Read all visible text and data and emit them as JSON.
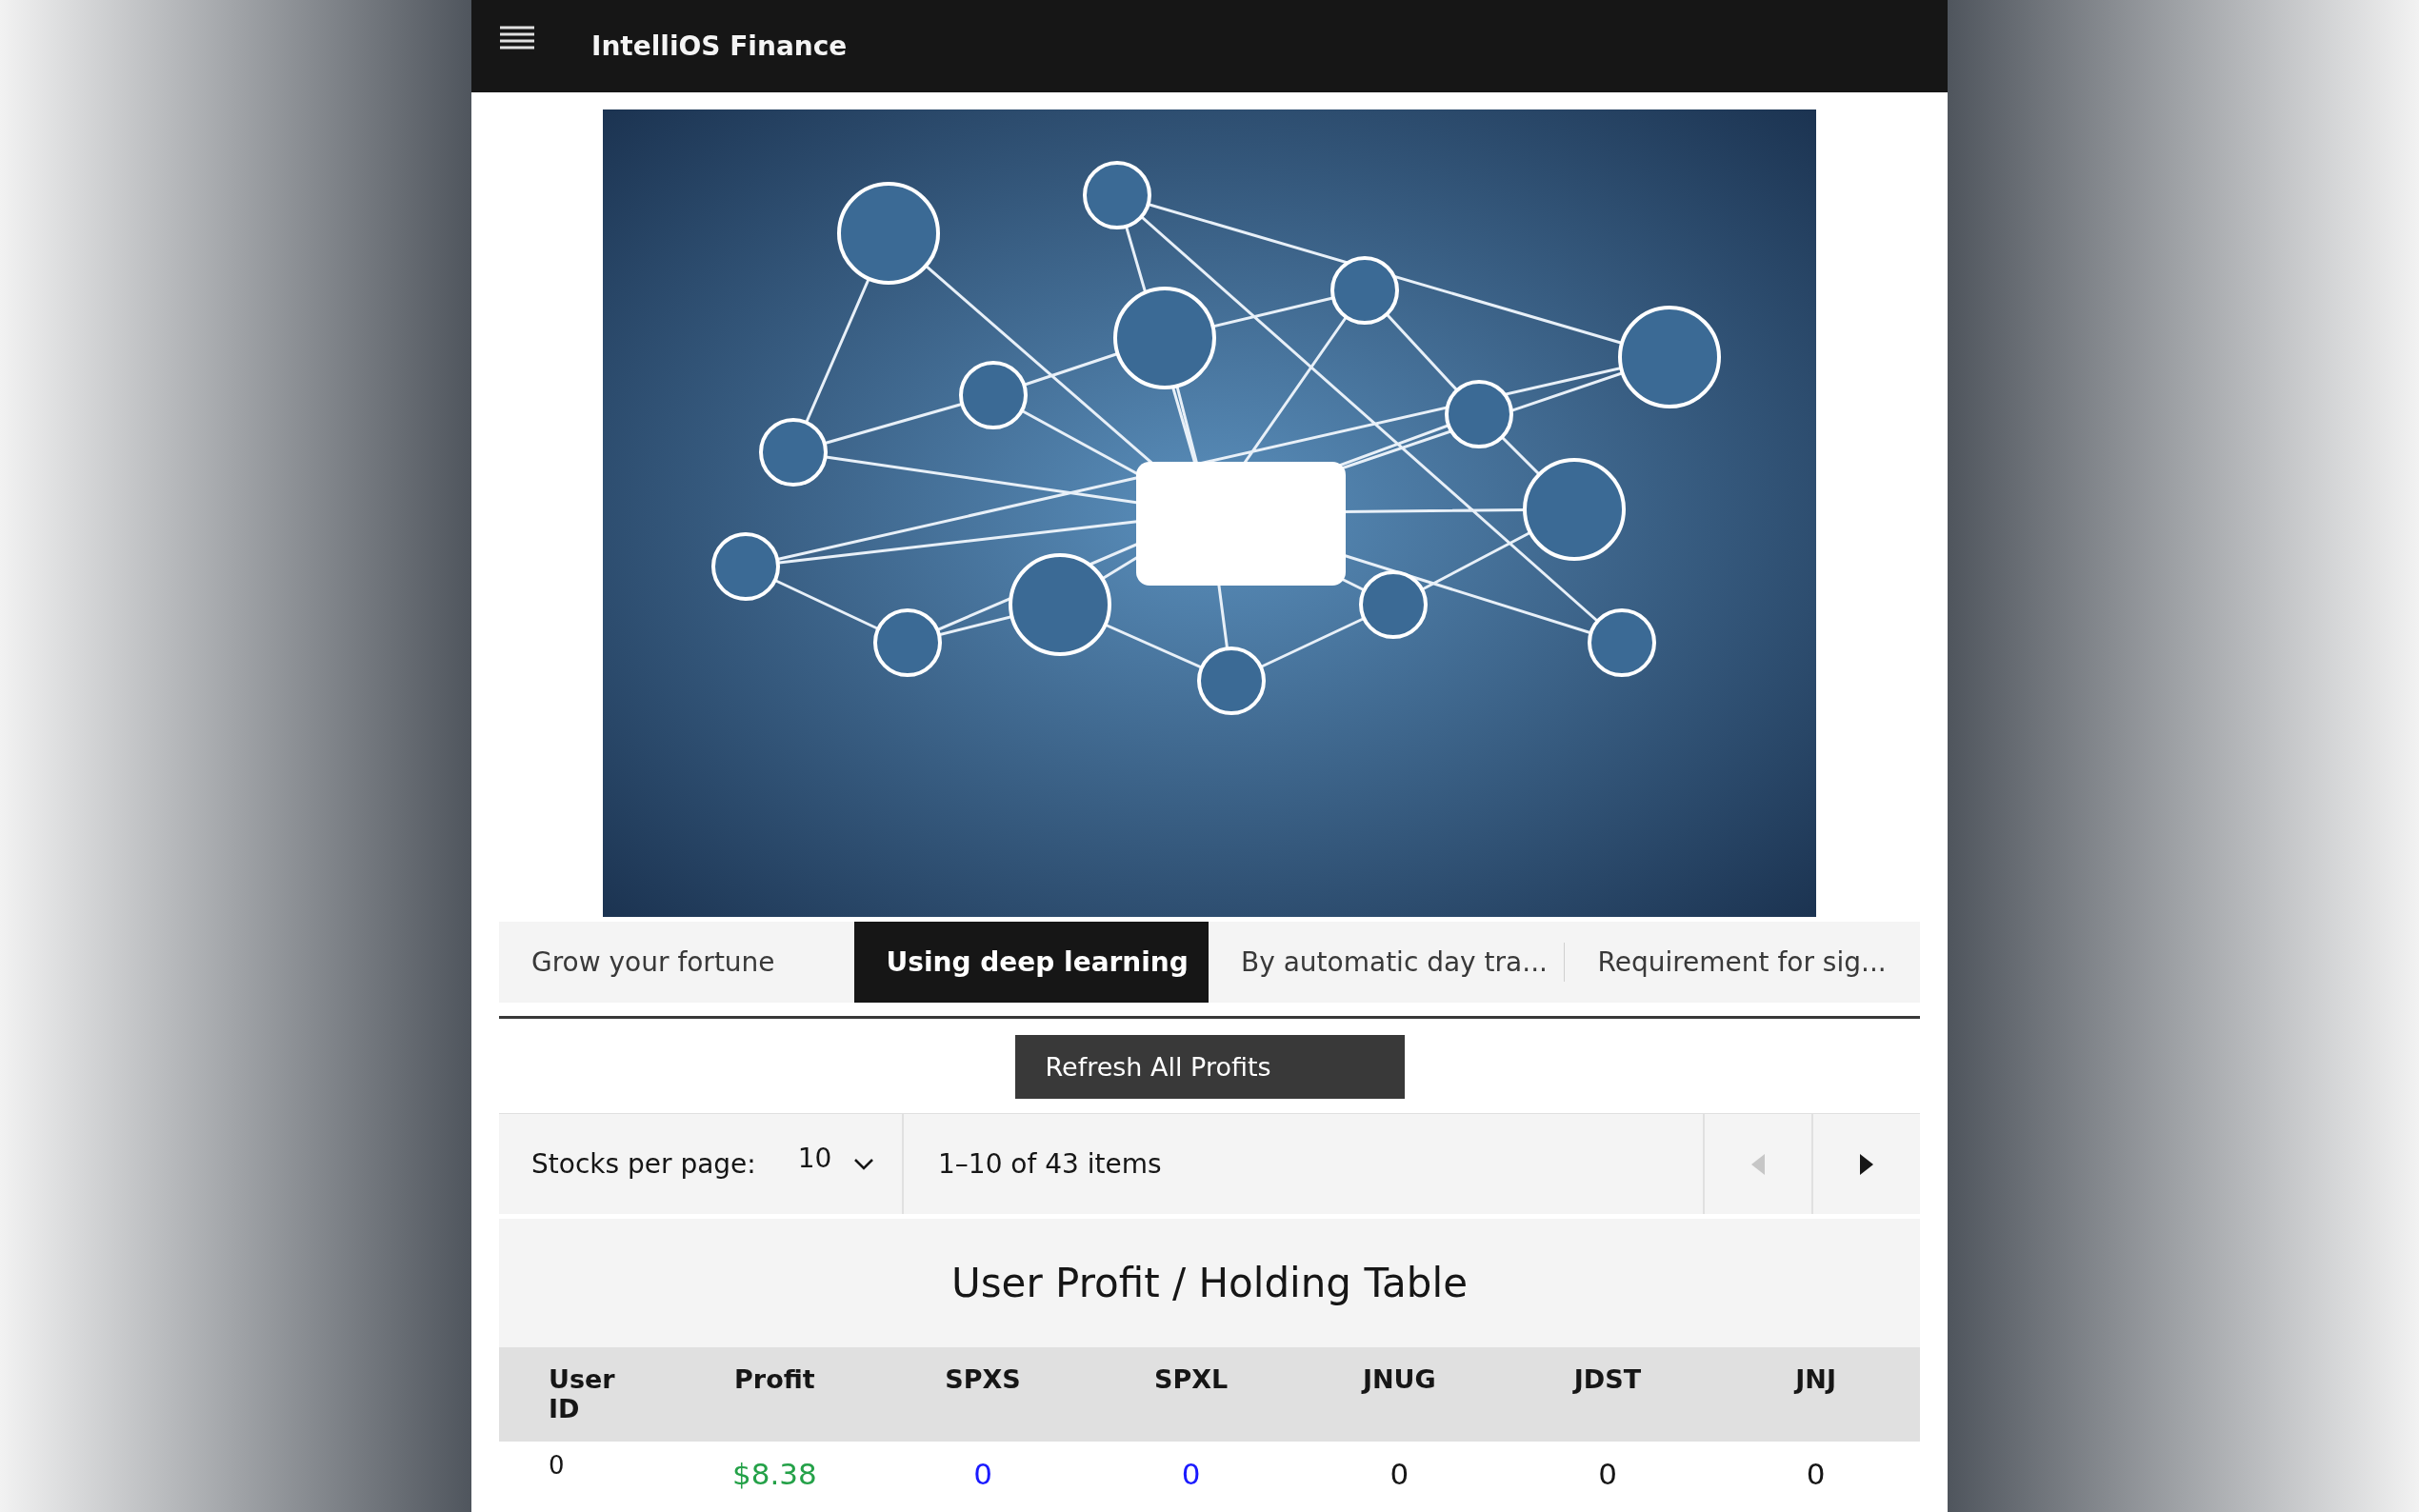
{
  "header": {
    "title": "IntelliOS Finance"
  },
  "tabs": [
    {
      "label": "Grow your fortune",
      "selected": false
    },
    {
      "label": "Using deep learning",
      "selected": true
    },
    {
      "label": "By automatic day tra...",
      "selected": false
    },
    {
      "label": "Requirement for sig...",
      "selected": false
    }
  ],
  "refresh_button": "Refresh All Profits",
  "pagination": {
    "label": "Stocks per page:",
    "page_size": "10",
    "range": "1–10 of 43 items",
    "previous": {
      "disabled": true
    },
    "next": {
      "disabled": false
    }
  },
  "table": {
    "title": "User Profit / Holding Table",
    "columns": [
      "User ID",
      "Profit",
      "SPXS",
      "SPXL",
      "JNUG",
      "JDST",
      "JNJ"
    ],
    "rows": [
      [
        {
          "text": "0",
          "kind": "id"
        },
        {
          "text": "$8.38",
          "kind": "profit"
        },
        {
          "text": "0",
          "kind": "link"
        },
        {
          "text": "0",
          "kind": "link"
        },
        {
          "text": "0",
          "kind": "plain"
        },
        {
          "text": "0",
          "kind": "plain"
        },
        {
          "text": "0",
          "kind": "plain"
        }
      ]
    ]
  }
}
